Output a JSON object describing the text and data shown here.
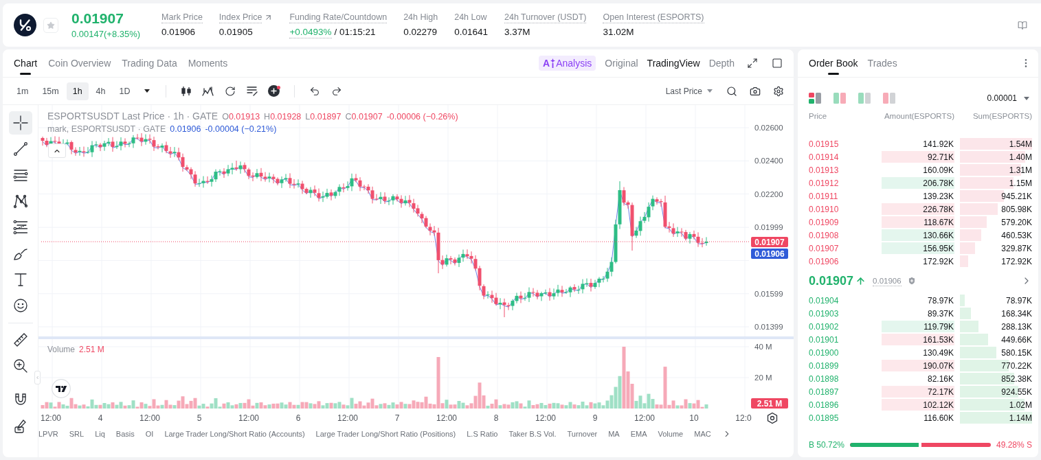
{
  "header": {
    "price": "0.01907",
    "change": "0.00147(+8.35%)",
    "favorite": false,
    "stats": [
      {
        "label": "Mark Price",
        "value": "0.01906",
        "tooltip": true,
        "link": false,
        "positive": false
      },
      {
        "label": "Index Price",
        "value": "0.01905",
        "tooltip": true,
        "link": true,
        "positive": false
      },
      {
        "label": "Funding Rate/Countdown",
        "value": "+0.0493%",
        "countdown": "/ 01:15:21",
        "tooltip": true,
        "link": false,
        "positive": true
      },
      {
        "label": "24h High",
        "value": "0.02279",
        "tooltip": false,
        "link": false,
        "positive": false
      },
      {
        "label": "24h Low",
        "value": "0.01641",
        "tooltip": false,
        "link": false,
        "positive": false
      },
      {
        "label": "24h Turnover (USDT)",
        "value": "3.37M",
        "tooltip": true,
        "link": false,
        "positive": false
      },
      {
        "label": "Open Interest (ESPORTS)",
        "value": "31.02M",
        "tooltip": true,
        "link": false,
        "positive": false
      }
    ]
  },
  "chart_panel": {
    "tabs": [
      {
        "label": "Chart",
        "selected": true
      },
      {
        "label": "Coin Overview",
        "selected": false
      },
      {
        "label": "Trading Data",
        "selected": false
      },
      {
        "label": "Moments",
        "selected": false
      }
    ],
    "ai_button": {
      "mark": "A",
      "label": "Analysis"
    },
    "views": [
      {
        "label": "Original",
        "selected": false
      },
      {
        "label": "TradingView",
        "selected": true
      },
      {
        "label": "Depth",
        "selected": false
      }
    ],
    "intervals": [
      {
        "label": "1m",
        "selected": false
      },
      {
        "label": "15m",
        "selected": false
      },
      {
        "label": "1h",
        "selected": true
      },
      {
        "label": "4h",
        "selected": false
      },
      {
        "label": "1D",
        "selected": false
      }
    ],
    "indicator_alert": true,
    "price_source": "Last Price",
    "drawing_tools": [
      {
        "selected": true
      },
      {
        "selected": false
      },
      {
        "selected": false
      },
      {
        "selected": false
      },
      {
        "selected": false
      },
      {
        "selected": false
      },
      {
        "selected": false
      },
      {
        "selected": false
      },
      {
        "selected": false
      },
      {
        "selected": false
      },
      {
        "selected": false
      },
      {
        "selected": false
      }
    ],
    "legend": {
      "title": "ESPORTSUSDT Last Price · 1h · GATE",
      "ohlc": [
        {
          "key": "O",
          "value": "0.01913"
        },
        {
          "key": "H",
          "value": "0.01928"
        },
        {
          "key": "L",
          "value": "0.01897"
        },
        {
          "key": "C",
          "value": "0.01907"
        }
      ],
      "change": "-0.00006 (−0.26%)"
    },
    "mark_legend": {
      "title": "mark, ESPORTSUSDT · GATE",
      "value": "0.01906",
      "change": "-0.00004 (−0.21%)"
    },
    "price_axis": [
      "0.02600",
      "0.02400",
      "0.02200",
      "0.01999",
      "0.01599",
      "0.01399"
    ],
    "last_price_tag": "0.01907",
    "mark_price_tag": "0.01906",
    "volume": {
      "label": "Volume",
      "value": "2.51 M",
      "axis": [
        "40 M",
        "20 M"
      ],
      "tag": "2.51 M"
    },
    "time_axis": [
      "12:00",
      "4",
      "12:00",
      "5",
      "12:00",
      "6",
      "12:00",
      "7",
      "12:00",
      "8",
      "12:00",
      "9",
      "12:00",
      "10",
      "12:0"
    ],
    "indicators": [
      "LPVR",
      "SRL",
      "Liq",
      "Basis",
      "OI",
      "Large Trader Long/Short Ratio (Accounts)",
      "Large Trader Long/Short Ratio (Positions)",
      "L.S Ratio",
      "Taker B.S Vol.",
      "Turnover",
      "MA",
      "EMA",
      "Volume",
      "MAC"
    ]
  },
  "order_book": {
    "tabs": [
      {
        "label": "Order Book",
        "selected": true
      },
      {
        "label": "Trades",
        "selected": false
      }
    ],
    "layouts": [
      {
        "selected": true
      },
      {
        "selected": false
      },
      {
        "selected": false
      },
      {
        "selected": false
      }
    ],
    "precision": "0.00001",
    "columns": [
      "Price",
      "Amount(ESPORTS)",
      "Sum(ESPORTS)"
    ],
    "asks": [
      {
        "price": "0.01915",
        "amount": "141.92K",
        "sum": "1.54M"
      },
      {
        "price": "0.01914",
        "amount": "92.71K",
        "sum": "1.40M",
        "color": "#fde8eb"
      },
      {
        "price": "0.01913",
        "amount": "160.09K",
        "sum": "1.31M"
      },
      {
        "price": "0.01912",
        "amount": "206.78K",
        "sum": "1.15M",
        "color": "#e4f6ee"
      },
      {
        "price": "0.01911",
        "amount": "139.23K",
        "sum": "945.21K"
      },
      {
        "price": "0.01910",
        "amount": "226.78K",
        "sum": "805.98K",
        "color": "#fde8eb"
      },
      {
        "price": "0.01909",
        "amount": "118.67K",
        "sum": "579.20K",
        "color": "#fde8eb"
      },
      {
        "price": "0.01908",
        "amount": "130.66K",
        "sum": "460.53K",
        "color": "#e4f6ee"
      },
      {
        "price": "0.01907",
        "amount": "156.95K",
        "sum": "329.87K",
        "color": "#e4f6ee"
      },
      {
        "price": "0.01906",
        "amount": "172.92K",
        "sum": "172.92K"
      }
    ],
    "last": {
      "price": "0.01907",
      "rising": true,
      "mark": "0.01906"
    },
    "bids": [
      {
        "price": "0.01904",
        "amount": "78.97K",
        "sum": "78.97K"
      },
      {
        "price": "0.01903",
        "amount": "89.37K",
        "sum": "168.34K"
      },
      {
        "price": "0.01902",
        "amount": "119.79K",
        "sum": "288.13K",
        "color": "#e4f6ee"
      },
      {
        "price": "0.01901",
        "amount": "161.53K",
        "sum": "449.66K",
        "color": "#fde8eb"
      },
      {
        "price": "0.01900",
        "amount": "130.49K",
        "sum": "580.15K"
      },
      {
        "price": "0.01899",
        "amount": "190.07K",
        "sum": "770.22K",
        "color": "#fde8eb"
      },
      {
        "price": "0.01898",
        "amount": "82.16K",
        "sum": "852.38K"
      },
      {
        "price": "0.01897",
        "amount": "72.17K",
        "sum": "924.55K",
        "color": "#fde8eb"
      },
      {
        "price": "0.01896",
        "amount": "102.12K",
        "sum": "1.02M",
        "color": "#fde8eb"
      },
      {
        "price": "0.01895",
        "amount": "116.60K",
        "sum": "1.14M"
      }
    ],
    "ratio": {
      "buy": "B 50.72%",
      "sell": "49.28% S",
      "level": 0.5072
    }
  }
}
